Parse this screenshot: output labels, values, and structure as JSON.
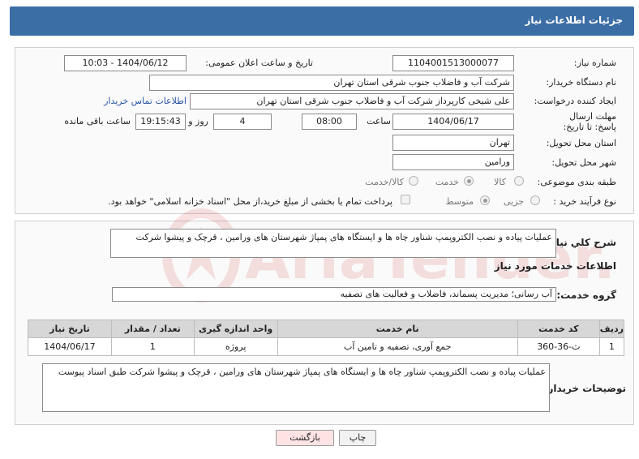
{
  "header": {
    "title": "جزئیات اطلاعات نیاز"
  },
  "form": {
    "need_number_label": "شماره نیاز:",
    "need_number": "1104001513000077",
    "announce_label": "تاریخ و ساعت اعلان عمومی:",
    "announce_value": "1404/06/12 - 10:03",
    "buyer_label": "نام دستگاه خریدار:",
    "buyer_value": "شرکت آب و فاضلاب جنوب شرقی استان تهران",
    "creator_label": "ایجاد کننده درخواست:",
    "creator_value": "علی شیخی کارپرداز شرکت آب و فاضلاب جنوب شرقی استان تهران",
    "contact_link": "اطلاعات تماس خریدار",
    "deadline_label": "مهلت ارسال پاسخ: تا تاریخ:",
    "deadline_date": "1404/06/17",
    "time_label": "ساعت",
    "deadline_time": "08:00",
    "days_value": "4",
    "days_label": "روز و",
    "remaining_time": "19:15:43",
    "remaining_label": "ساعت باقی مانده",
    "province_label": "استان محل تحویل:",
    "province_value": "تهران",
    "city_label": "شهر محل تحویل:",
    "city_value": "ورامین",
    "category_label": "طبقه بندی موضوعی:",
    "category_options": [
      "کالا",
      "خدمت",
      "کالا/خدمت"
    ],
    "category_selected": "خدمت",
    "process_label": "نوع فرآیند خرید :",
    "process_options": [
      "جزیی",
      "متوسط"
    ],
    "process_selected": "متوسط",
    "payment_note": "پرداخت تمام یا بخشی از مبلغ خرید،از محل \"اسناد خزانه اسلامی\" خواهد بود."
  },
  "summary": {
    "label": "شرح کلي نياز:",
    "text": "عملیات پیاده و نصب الکتروپمپ شناور چاه ها و ایستگاه های پمپاژ شهرستان های ورامین ، قرچک و پیشوا شرکت",
    "services_heading": "اطلاعات خدمات مورد نياز",
    "service_group_label": "گروه خدمت:",
    "service_group_value": "آب رسانی؛ مدیریت پسماند، فاضلاب و فعالیت های تصفیه"
  },
  "table": {
    "columns": [
      "ردیف",
      "کد خدمت",
      "نام خدمت",
      "واحد اندازه گیری",
      "تعداد / مقدار",
      "تاریخ نیاز"
    ],
    "rows": [
      [
        "1",
        "ث-36-360",
        "جمع آوری، تصفیه و تامین آب",
        "پروژه",
        "1",
        "1404/06/17"
      ]
    ]
  },
  "notes": {
    "label": "توضیحات خریدار:",
    "text": "عملیات پیاده و نصب الکتروپمپ شناور چاه ها و ایستگاه های پمپاژ شهرستان های ورامین ، قرچک و پیشوا شرکت طبق اسناد پیوست"
  },
  "buttons": {
    "print": "چاپ",
    "back": "بازگشت"
  },
  "watermark": {
    "text": "AriaTender.net"
  },
  "colors": {
    "header": "#3c6ea6",
    "link": "#2a56a8",
    "back_button": "#fde3e3",
    "watermark": "#cc2222"
  }
}
